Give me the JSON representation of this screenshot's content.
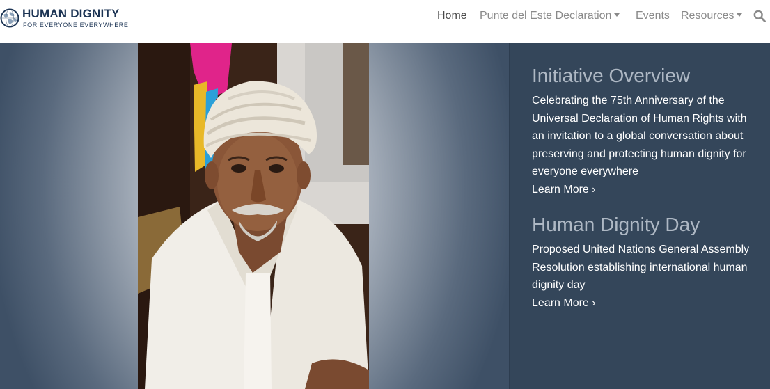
{
  "header": {
    "logo_title": "HUMAN DIGNITY",
    "logo_tagline": "FOR EVERYONE EVERYWHERE",
    "logo_icon": "globe-icon",
    "brand_color": "#1c3454"
  },
  "nav": {
    "items": [
      {
        "label": "Home",
        "active": true,
        "dropdown": false
      },
      {
        "label": "Punte del Este Declaration",
        "active": false,
        "dropdown": true
      },
      {
        "label": "Events",
        "active": false,
        "dropdown": false
      },
      {
        "label": "Resources",
        "active": false,
        "dropdown": true
      }
    ],
    "search_icon": "search-icon"
  },
  "hero": {
    "image_icon": "portrait-photo",
    "sections": [
      {
        "heading": "Initiative Overview",
        "text": "Celebrating the 75th Anniversary of the Universal Declaration of Human Rights with an invitation to a global conversation about preserving and protecting human dignity for everyone everywhere",
        "link": "Learn More ›"
      },
      {
        "heading": "Human Dignity Day",
        "text": "Proposed United Nations General Assembly Resolution establishing international human dignity day",
        "link": "Learn More ›"
      }
    ],
    "panel_color": "#34465a",
    "heading_color": "#aeb8c4"
  }
}
